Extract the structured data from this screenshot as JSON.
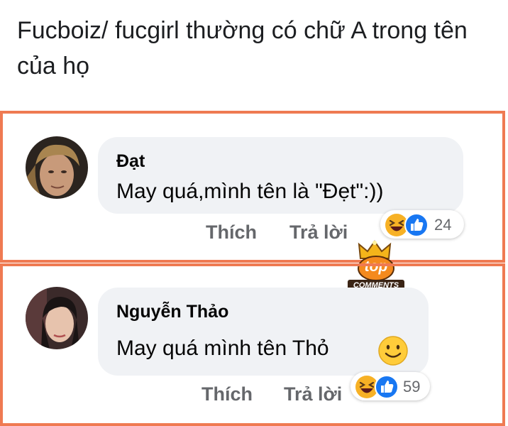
{
  "post": {
    "title": "Fucboiz/ fucgirl thường có chữ A trong tên của họ"
  },
  "comments": [
    {
      "author": "Đạt",
      "text": "May quá,mình tên là \"Đẹt\":))",
      "like_label": "Thích",
      "reply_label": "Trả lời",
      "reaction_count": "24"
    },
    {
      "author": "Nguyễn Thảo",
      "text": "May quá mình tên Thỏ",
      "like_label": "Thích",
      "reply_label": "Trả lời",
      "reaction_count": "59"
    }
  ],
  "badge": {
    "top": "top",
    "comments": "COMMENTS"
  },
  "icons": [
    "haha-icon",
    "like-icon",
    "smile-emoji-icon",
    "crown-icon"
  ],
  "colors": {
    "highlight_border": "#ef7a52",
    "bubble": "#f0f2f5",
    "like_blue": "#1877f2",
    "haha_yellow": "#f7b125",
    "badge_orange": "#f48a1e"
  }
}
